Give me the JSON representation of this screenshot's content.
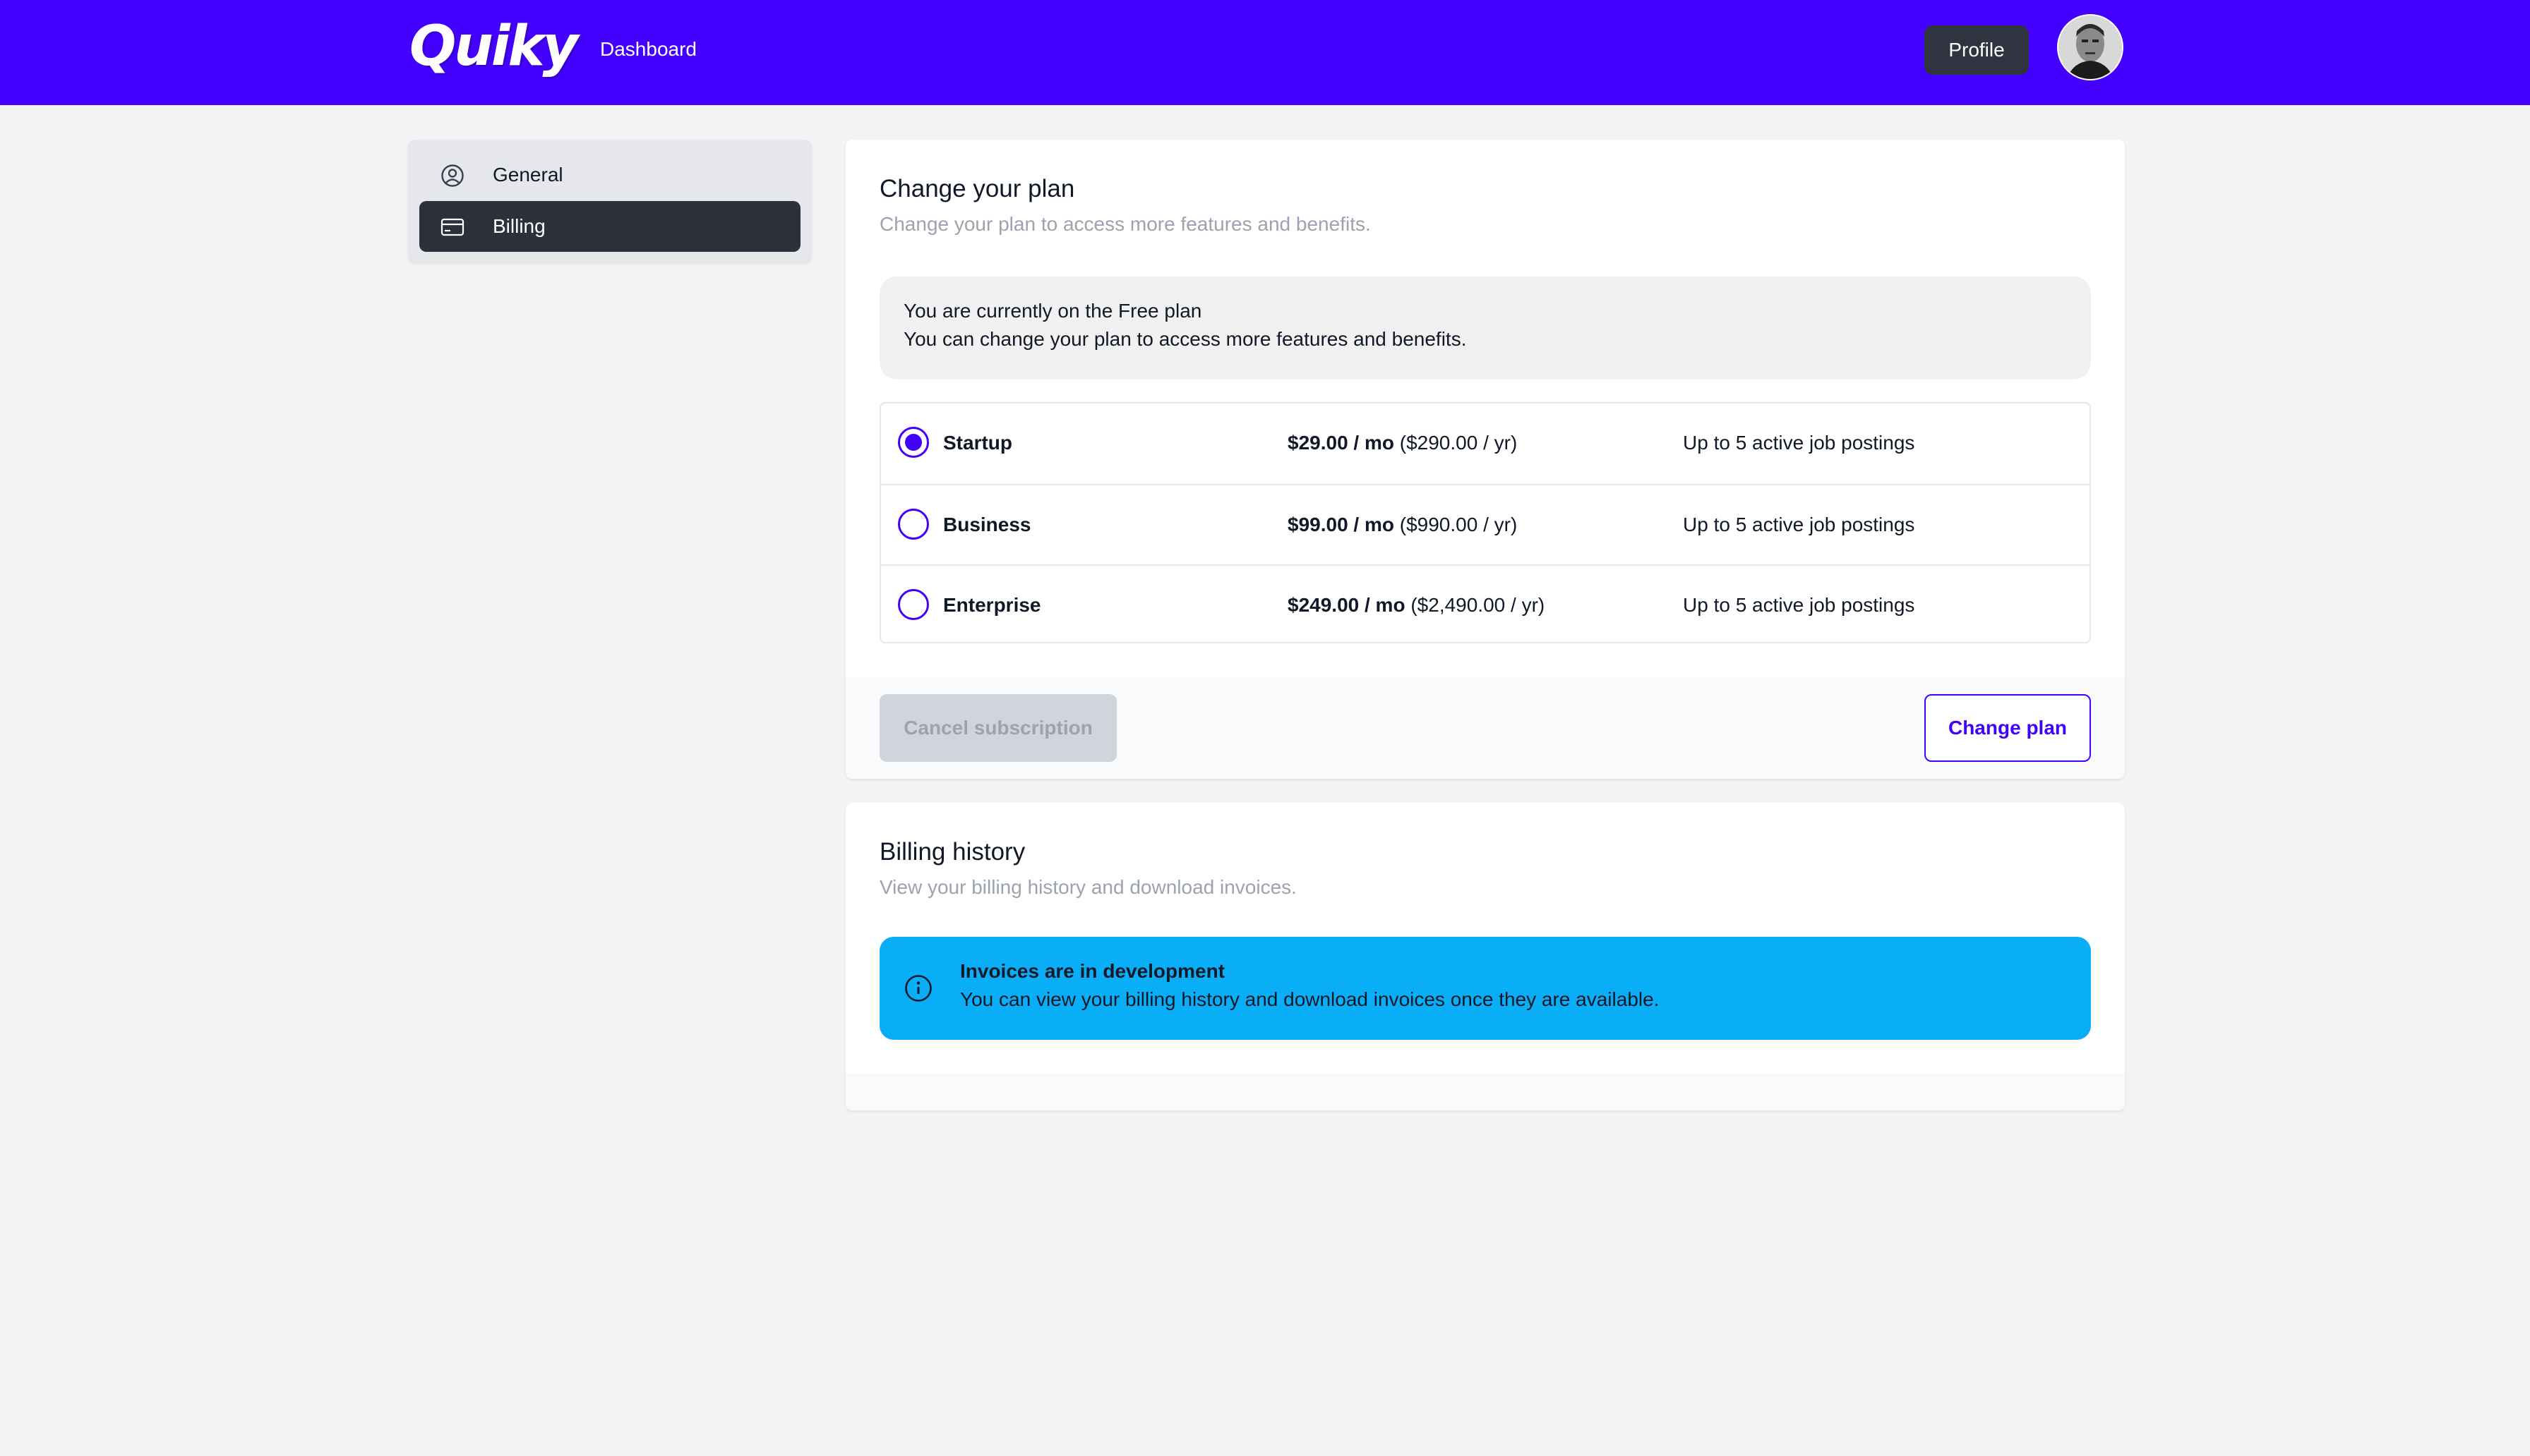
{
  "header": {
    "logo": "Quiky",
    "nav_dashboard": "Dashboard",
    "profile_label": "Profile",
    "brand_color": "#4400ff"
  },
  "sidebar": {
    "items": [
      {
        "label": "General",
        "icon": "user-circle-icon",
        "active": false
      },
      {
        "label": "Billing",
        "icon": "credit-card-icon",
        "active": true
      }
    ]
  },
  "plan_card": {
    "title": "Change your plan",
    "subtitle": "Change your plan to access more features and benefits.",
    "current": {
      "line1": "You are currently on the Free plan",
      "line2": "You can change your plan to access more features and benefits."
    },
    "plans": [
      {
        "name": "Startup",
        "price_mo": "$29.00 / mo",
        "price_yr": "($290.00 / yr)",
        "desc": "Up to 5 active job postings",
        "selected": true
      },
      {
        "name": "Business",
        "price_mo": "$99.00 / mo",
        "price_yr": "($990.00 / yr)",
        "desc": "Up to 5 active job postings",
        "selected": false
      },
      {
        "name": "Enterprise",
        "price_mo": "$249.00 / mo",
        "price_yr": "($2,490.00 / yr)",
        "desc": "Up to 5 active job postings",
        "selected": false
      }
    ],
    "cancel_label": "Cancel subscription",
    "change_label": "Change plan"
  },
  "history_card": {
    "title": "Billing history",
    "subtitle": "View your billing history and download invoices.",
    "notice": {
      "title": "Invoices are in development",
      "text": "You can view your billing history and download invoices once they are available.",
      "icon": "info-icon",
      "color": "#0aaef7"
    }
  }
}
